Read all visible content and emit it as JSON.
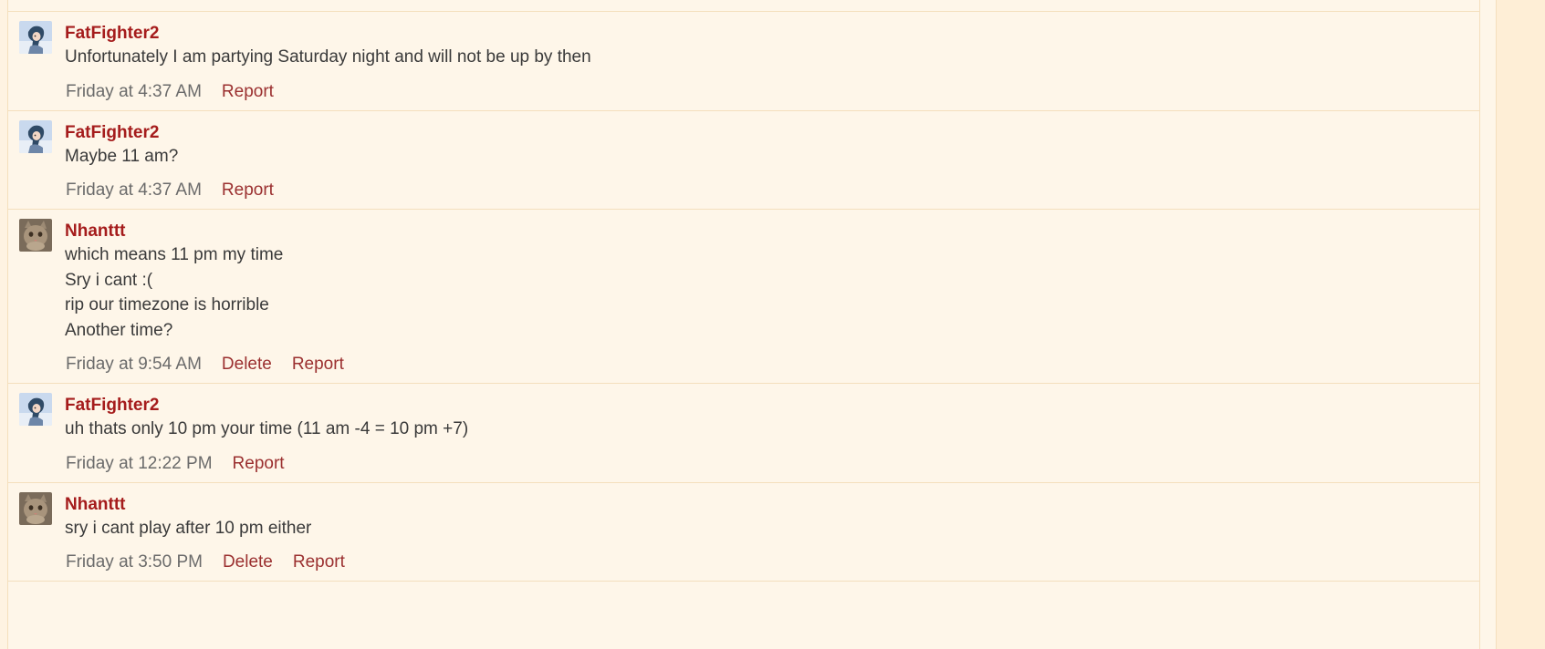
{
  "colors": {
    "username": "#a51c1c",
    "action_link": "#9b3030",
    "body_text": "#3a3a3a",
    "timestamp": "#6b6b6b",
    "background": "#fef6e9",
    "border": "#f4dfbd"
  },
  "messages": [
    {
      "user": "FatFighter2",
      "avatar": "anime-avatar",
      "lines": [
        "Unfortunately I am partying Saturday night and will not be up by then"
      ],
      "time": "Friday at 4:37 AM",
      "actions": [
        "Report"
      ]
    },
    {
      "user": "FatFighter2",
      "avatar": "anime-avatar",
      "lines": [
        "Maybe 11 am?"
      ],
      "time": "Friday at 4:37 AM",
      "actions": [
        "Report"
      ]
    },
    {
      "user": "Nhanttt",
      "avatar": "cat-avatar",
      "lines": [
        "which means 11 pm my time",
        "Sry i cant :(",
        "rip our timezone is horrible",
        "Another time?"
      ],
      "time": "Friday at 9:54 AM",
      "actions": [
        "Delete",
        "Report"
      ]
    },
    {
      "user": "FatFighter2",
      "avatar": "anime-avatar",
      "lines": [
        "uh thats only 10 pm your time (11 am -4 = 10 pm +7)"
      ],
      "time": "Friday at 12:22 PM",
      "actions": [
        "Report"
      ]
    },
    {
      "user": "Nhanttt",
      "avatar": "cat-avatar",
      "lines": [
        "sry i cant play after 10 pm either"
      ],
      "time": "Friday at 3:50 PM",
      "actions": [
        "Delete",
        "Report"
      ]
    }
  ]
}
